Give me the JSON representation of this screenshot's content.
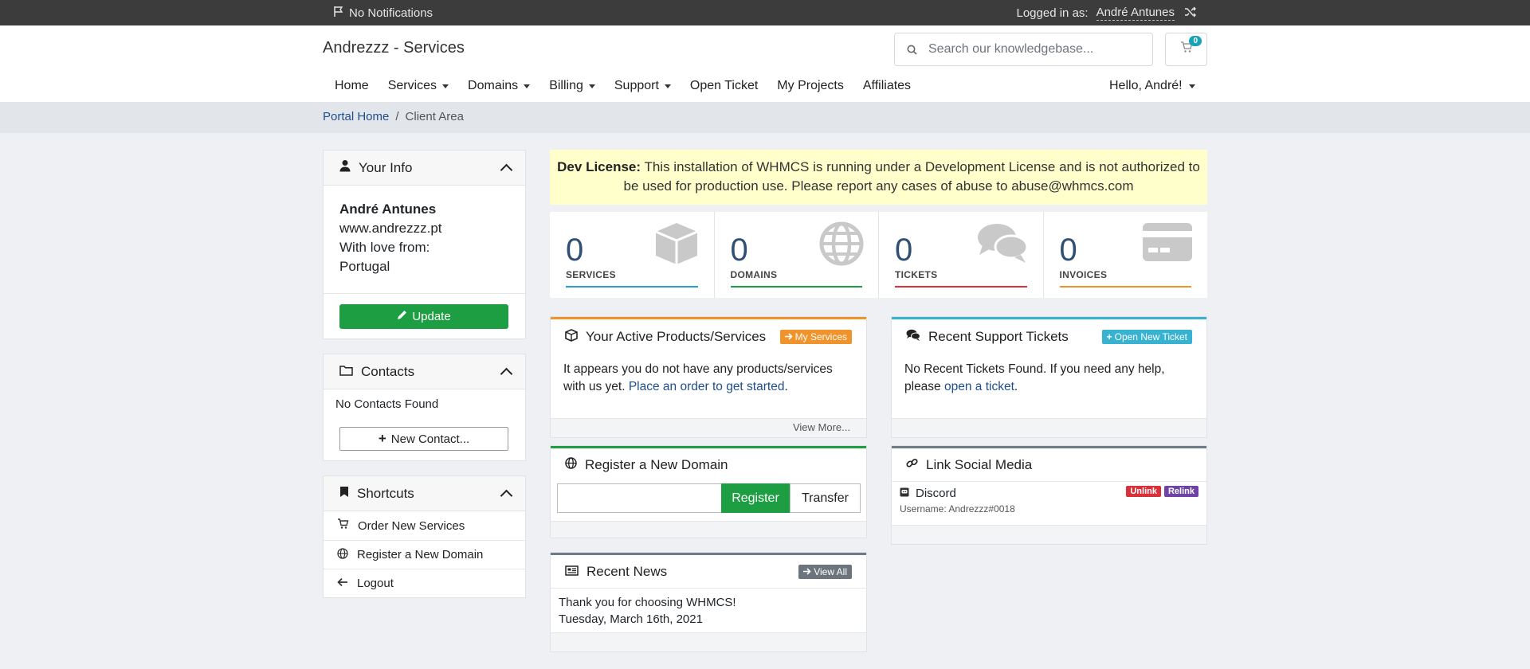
{
  "topbar": {
    "notifications": "No Notifications",
    "logged_in_label": "Logged in as:",
    "user_name": "André Antunes"
  },
  "header": {
    "brand": "Andrezzz - Services",
    "search_placeholder": "Search our knowledgebase...",
    "cart_count": "0",
    "nav": [
      "Home",
      "Services",
      "Domains",
      "Billing",
      "Support",
      "Open Ticket",
      "My Projects",
      "Affiliates"
    ],
    "hello": "Hello, André!"
  },
  "breadcrumb": {
    "home": "Portal Home",
    "separator": "/",
    "current": "Client Area"
  },
  "your_info": {
    "title": "Your Info",
    "name": "André Antunes",
    "line1": "www.andrezzz.pt",
    "line2": "With love from:",
    "line3": "Portugal",
    "update_label": "Update"
  },
  "contacts": {
    "title": "Contacts",
    "empty": "No Contacts Found",
    "new_label": "New Contact..."
  },
  "shortcuts": {
    "title": "Shortcuts",
    "items": [
      "Order New Services",
      "Register a New Domain",
      "Logout"
    ]
  },
  "license": {
    "bold": "Dev License:",
    "text": "This installation of WHMCS is running under a Development License and is not authorized to be used for production use. Please report any cases of abuse to abuse@whmcs.com"
  },
  "stats": [
    {
      "value": "0",
      "label": "SERVICES",
      "color": "#2a9fd6"
    },
    {
      "value": "0",
      "label": "DOMAINS",
      "color": "#1e9e43"
    },
    {
      "value": "0",
      "label": "TICKETS",
      "color": "#d9303a"
    },
    {
      "value": "0",
      "label": "INVOICES",
      "color": "#f0932b"
    }
  ],
  "products": {
    "title": "Your Active Products/Services",
    "button": "My Services",
    "text": "It appears you do not have any products/services with us yet.",
    "link": "Place an order to get started",
    "end": ".",
    "footer": "View More..."
  },
  "tickets": {
    "title": "Recent Support Tickets",
    "button": "Open New Ticket",
    "text": "No Recent Tickets Found. If you need any help, please",
    "link": "open a ticket",
    "end": "."
  },
  "domain": {
    "title": "Register a New Domain",
    "register": "Register",
    "transfer": "Transfer"
  },
  "social": {
    "title": "Link Social Media",
    "service": "Discord",
    "unlink": "Unlink",
    "relink": "Relink",
    "username": "Username: Andrezzz#0018"
  },
  "news": {
    "title": "Recent News",
    "button": "View All",
    "headline": "Thank you for choosing WHMCS!",
    "date": "Tuesday, March 16th, 2021"
  }
}
